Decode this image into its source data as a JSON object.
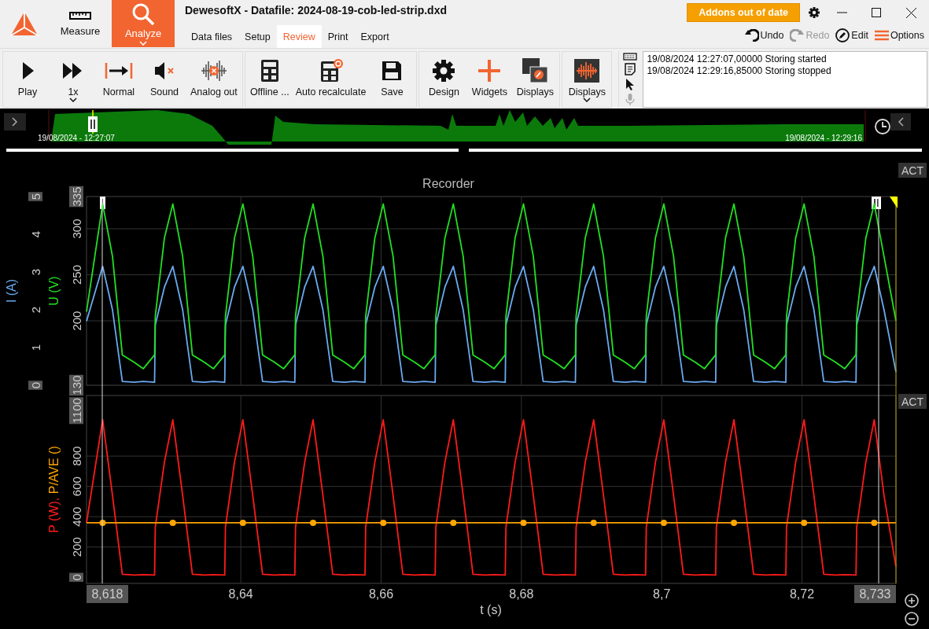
{
  "app": {
    "title": "DewesoftX - Datafile: 2024-08-19-cob-led-strip.dxd",
    "modes": [
      {
        "label": "Measure",
        "selected": false
      },
      {
        "label": "Analyze",
        "selected": true
      }
    ],
    "tabs": [
      {
        "label": "Data files",
        "selected": false
      },
      {
        "label": "Setup",
        "selected": false
      },
      {
        "label": "Review",
        "selected": true
      },
      {
        "label": "Print",
        "selected": false
      },
      {
        "label": "Export",
        "selected": false
      }
    ],
    "addons_button": "Addons out of date",
    "actions": [
      {
        "label": "Undo",
        "disabled": false
      },
      {
        "label": "Redo",
        "disabled": true
      },
      {
        "label": "Edit",
        "disabled": false
      },
      {
        "label": "Options",
        "disabled": false
      }
    ]
  },
  "toolbar": {
    "groups": [
      [
        {
          "label": "Play",
          "dropdown": false
        },
        {
          "label": "1x",
          "dropdown": true
        },
        {
          "label": "Normal",
          "dropdown": false
        },
        {
          "label": "Sound",
          "dropdown": false
        },
        {
          "label": "Analog out",
          "dropdown": false
        }
      ],
      [
        {
          "label": "Offline ...",
          "dropdown": false
        },
        {
          "label": "Auto recalculate",
          "dropdown": false
        },
        {
          "label": "Save",
          "dropdown": false
        }
      ],
      [
        {
          "label": "Design",
          "dropdown": false
        },
        {
          "label": "Widgets",
          "dropdown": false
        },
        {
          "label": "Displays",
          "dropdown": false
        }
      ],
      [
        {
          "label": "Displays",
          "dropdown": true
        }
      ]
    ],
    "side_tools": [
      {
        "disabled": false
      },
      {
        "disabled": false
      },
      {
        "disabled": false
      },
      {
        "disabled": true
      }
    ]
  },
  "event_log": [
    "19/08/2024 12:27:07,00000 Storing started",
    "19/08/2024 12:29:16,85000 Storing stopped"
  ],
  "overview": {
    "start_time": "19/08/2024 - 12:27:07",
    "end_time": "19/08/2024 - 12:29:16"
  },
  "recorder": {
    "title": "Recorder",
    "act_labels": [
      "ACT",
      "ACT"
    ],
    "cursors": [
      "8,618",
      "8,733"
    ],
    "charts": [
      {
        "chart_data": {
          "type": "line",
          "ylabel": "I (A)",
          "xlim": [
            8.618,
            8.7334
          ],
          "ylim": [
            0,
            5
          ],
          "yticks": [
            0,
            1,
            2,
            3,
            4,
            5
          ],
          "x": [
            8.618,
            8.6203,
            8.6217,
            8.6231,
            8.6248,
            8.6261,
            8.6277,
            8.6278,
            8.6291,
            8.6303,
            8.6317,
            8.6331,
            8.6348,
            8.6361,
            8.6377,
            8.6378,
            8.6391,
            8.6403,
            8.6417,
            8.6431,
            8.6448,
            8.6461,
            8.6477,
            8.6478,
            8.6491,
            8.6503,
            8.6517,
            8.6531,
            8.6548,
            8.6561,
            8.6577,
            8.6578,
            8.6591,
            8.6603,
            8.6617,
            8.6631,
            8.6648,
            8.6661,
            8.6677,
            8.6678,
            8.6691,
            8.6703,
            8.6717,
            8.6731,
            8.6748,
            8.6761,
            8.6777,
            8.6778,
            8.6791,
            8.6803,
            8.6817,
            8.6831,
            8.6848,
            8.6861,
            8.6877,
            8.6878,
            8.6891,
            8.6903,
            8.6917,
            8.6931,
            8.6948,
            8.6961,
            8.6977,
            8.6978,
            8.6991,
            8.7003,
            8.7017,
            8.7031,
            8.7048,
            8.7061,
            8.7077,
            8.7078,
            8.7091,
            8.7103,
            8.7117,
            8.7131,
            8.7148,
            8.7161,
            8.7177,
            8.7178,
            8.7191,
            8.7203,
            8.7217,
            8.7231,
            8.7248,
            8.7261,
            8.7277,
            8.7278,
            8.7291,
            8.7303,
            8.7317,
            8.7334
          ],
          "series": [
            {
              "color": "#6aaaf0",
              "values": [
                1.7,
                3.15,
                2.0,
                0.1,
                0.08,
                0.1,
                0.08,
                1.6,
                2.6,
                3.15,
                2.0,
                0.1,
                0.08,
                0.1,
                0.08,
                1.6,
                2.6,
                3.15,
                2.0,
                0.1,
                0.08,
                0.1,
                0.08,
                1.6,
                2.6,
                3.15,
                2.0,
                0.1,
                0.08,
                0.1,
                0.08,
                1.6,
                2.6,
                3.15,
                2.0,
                0.1,
                0.08,
                0.1,
                0.08,
                1.6,
                2.6,
                3.15,
                2.0,
                0.1,
                0.08,
                0.1,
                0.08,
                1.6,
                2.6,
                3.15,
                2.0,
                0.1,
                0.08,
                0.1,
                0.08,
                1.6,
                2.6,
                3.15,
                2.0,
                0.1,
                0.08,
                0.1,
                0.08,
                1.6,
                2.6,
                3.15,
                2.0,
                0.1,
                0.08,
                0.1,
                0.08,
                1.6,
                2.6,
                3.15,
                2.0,
                0.1,
                0.08,
                0.1,
                0.08,
                1.6,
                2.6,
                3.15,
                2.0,
                0.1,
                0.08,
                0.1,
                0.08,
                1.6,
                2.6,
                3.15,
                2.0,
                0.35
              ]
            }
          ]
        }
      },
      {
        "chart_data": {
          "type": "line",
          "ylabel": "U (V)",
          "xlim": [
            8.618,
            8.7334
          ],
          "ylim": [
            130,
            335
          ],
          "yticks": [
            130,
            200,
            250,
            300,
            335
          ],
          "x": [
            8.618,
            8.6203,
            8.6217,
            8.6231,
            8.6248,
            8.6261,
            8.6277,
            8.6278,
            8.6291,
            8.6303,
            8.6317,
            8.6331,
            8.6348,
            8.6361,
            8.6377,
            8.6378,
            8.6391,
            8.6403,
            8.6417,
            8.6431,
            8.6448,
            8.6461,
            8.6477,
            8.6478,
            8.6491,
            8.6503,
            8.6517,
            8.6531,
            8.6548,
            8.6561,
            8.6577,
            8.6578,
            8.6591,
            8.6603,
            8.6617,
            8.6631,
            8.6648,
            8.6661,
            8.6677,
            8.6678,
            8.6691,
            8.6703,
            8.6717,
            8.6731,
            8.6748,
            8.6761,
            8.6777,
            8.6778,
            8.6791,
            8.6803,
            8.6817,
            8.6831,
            8.6848,
            8.6861,
            8.6877,
            8.6878,
            8.6891,
            8.6903,
            8.6917,
            8.6931,
            8.6948,
            8.6961,
            8.6977,
            8.6978,
            8.6991,
            8.7003,
            8.7017,
            8.7031,
            8.7048,
            8.7061,
            8.7077,
            8.7078,
            8.7091,
            8.7103,
            8.7117,
            8.7131,
            8.7148,
            8.7161,
            8.7177,
            8.7178,
            8.7191,
            8.7203,
            8.7217,
            8.7231,
            8.7248,
            8.7261,
            8.7277,
            8.7278,
            8.7291,
            8.7303,
            8.7317,
            8.7334
          ],
          "series": [
            {
              "color": "#22e022",
              "values": [
                210,
                327,
                270,
                163,
                155,
                148,
                163,
                205,
                290,
                327,
                270,
                163,
                155,
                148,
                163,
                205,
                290,
                327,
                270,
                163,
                155,
                148,
                163,
                205,
                290,
                327,
                270,
                163,
                155,
                148,
                163,
                205,
                290,
                327,
                270,
                163,
                155,
                148,
                163,
                205,
                290,
                327,
                270,
                163,
                155,
                148,
                163,
                205,
                290,
                327,
                270,
                163,
                155,
                148,
                163,
                205,
                290,
                327,
                270,
                163,
                155,
                148,
                163,
                205,
                290,
                327,
                270,
                163,
                155,
                148,
                163,
                205,
                290,
                327,
                270,
                163,
                155,
                148,
                163,
                205,
                290,
                327,
                270,
                163,
                155,
                148,
                163,
                205,
                290,
                327,
                270,
                200
              ]
            }
          ]
        }
      },
      {
        "chart_data": {
          "type": "line",
          "xlabel": "t (s)",
          "ylabel": "P (W), P/AVE ()",
          "xlim": [
            8.618,
            8.7334
          ],
          "ylim": [
            -40,
            1200
          ],
          "yticks": [
            0,
            200,
            400,
            600,
            800,
            1100
          ],
          "xticks": [
            {
              "value": 8.64,
              "label": "8,64"
            },
            {
              "value": 8.66,
              "label": "8,66"
            },
            {
              "value": 8.68,
              "label": "8,68"
            },
            {
              "value": 8.7,
              "label": "8,7"
            },
            {
              "value": 8.72,
              "label": "8,72"
            }
          ],
          "x": [
            8.618,
            8.6203,
            8.6217,
            8.6231,
            8.6248,
            8.6261,
            8.6277,
            8.6278,
            8.6291,
            8.6303,
            8.6317,
            8.6331,
            8.6348,
            8.6361,
            8.6377,
            8.6378,
            8.6391,
            8.6403,
            8.6417,
            8.6431,
            8.6448,
            8.6461,
            8.6477,
            8.6478,
            8.6491,
            8.6503,
            8.6517,
            8.6531,
            8.6548,
            8.6561,
            8.6577,
            8.6578,
            8.6591,
            8.6603,
            8.6617,
            8.6631,
            8.6648,
            8.6661,
            8.6677,
            8.6678,
            8.6691,
            8.6703,
            8.6717,
            8.6731,
            8.6748,
            8.6761,
            8.6777,
            8.6778,
            8.6791,
            8.6803,
            8.6817,
            8.6831,
            8.6848,
            8.6861,
            8.6877,
            8.6878,
            8.6891,
            8.6903,
            8.6917,
            8.6931,
            8.6948,
            8.6961,
            8.6977,
            8.6978,
            8.6991,
            8.7003,
            8.7017,
            8.7031,
            8.7048,
            8.7061,
            8.7077,
            8.7078,
            8.7091,
            8.7103,
            8.7117,
            8.7131,
            8.7148,
            8.7161,
            8.7177,
            8.7178,
            8.7191,
            8.7203,
            8.7217,
            8.7231,
            8.7248,
            8.7261,
            8.7277,
            8.7278,
            8.7291,
            8.7303,
            8.7317,
            8.7334
          ],
          "series": [
            {
              "color": "#ff1a1a",
              "values": [
                360,
                1040,
                540,
                20,
                15,
                18,
                15,
                330,
                760,
                1040,
                540,
                20,
                15,
                18,
                15,
                330,
                760,
                1040,
                540,
                20,
                15,
                18,
                15,
                330,
                760,
                1040,
                540,
                20,
                15,
                18,
                15,
                330,
                760,
                1040,
                540,
                20,
                15,
                18,
                15,
                330,
                760,
                1040,
                540,
                20,
                15,
                18,
                15,
                330,
                760,
                1040,
                540,
                20,
                15,
                18,
                15,
                330,
                760,
                1040,
                540,
                20,
                15,
                18,
                15,
                330,
                760,
                1040,
                540,
                20,
                15,
                18,
                15,
                330,
                760,
                1040,
                540,
                20,
                15,
                18,
                15,
                330,
                760,
                1040,
                540,
                20,
                15,
                18,
                15,
                330,
                760,
                1040,
                540,
                70
              ]
            },
            {
              "color": "#ffa500",
              "values": [
                360,
                360,
                360,
                360,
                360,
                360,
                360,
                360,
                360,
                360,
                360,
                360,
                360,
                360,
                360,
                360,
                360,
                360,
                360,
                360,
                360,
                360,
                360,
                360,
                360,
                360,
                360,
                360,
                360,
                360,
                360,
                360,
                360,
                360,
                360,
                360,
                360,
                360,
                360,
                360,
                360,
                360,
                360,
                360,
                360,
                360,
                360,
                360,
                360,
                360,
                360,
                360,
                360,
                360,
                360,
                360,
                360,
                360,
                360,
                360,
                360,
                360,
                360,
                360,
                360,
                360,
                360,
                360,
                360,
                360,
                360,
                360,
                360,
                360,
                360,
                360,
                360,
                360,
                360,
                360,
                360,
                360,
                360,
                360,
                360,
                360,
                360,
                360,
                360,
                360,
                360,
                360
              ]
            }
          ]
        }
      }
    ]
  }
}
